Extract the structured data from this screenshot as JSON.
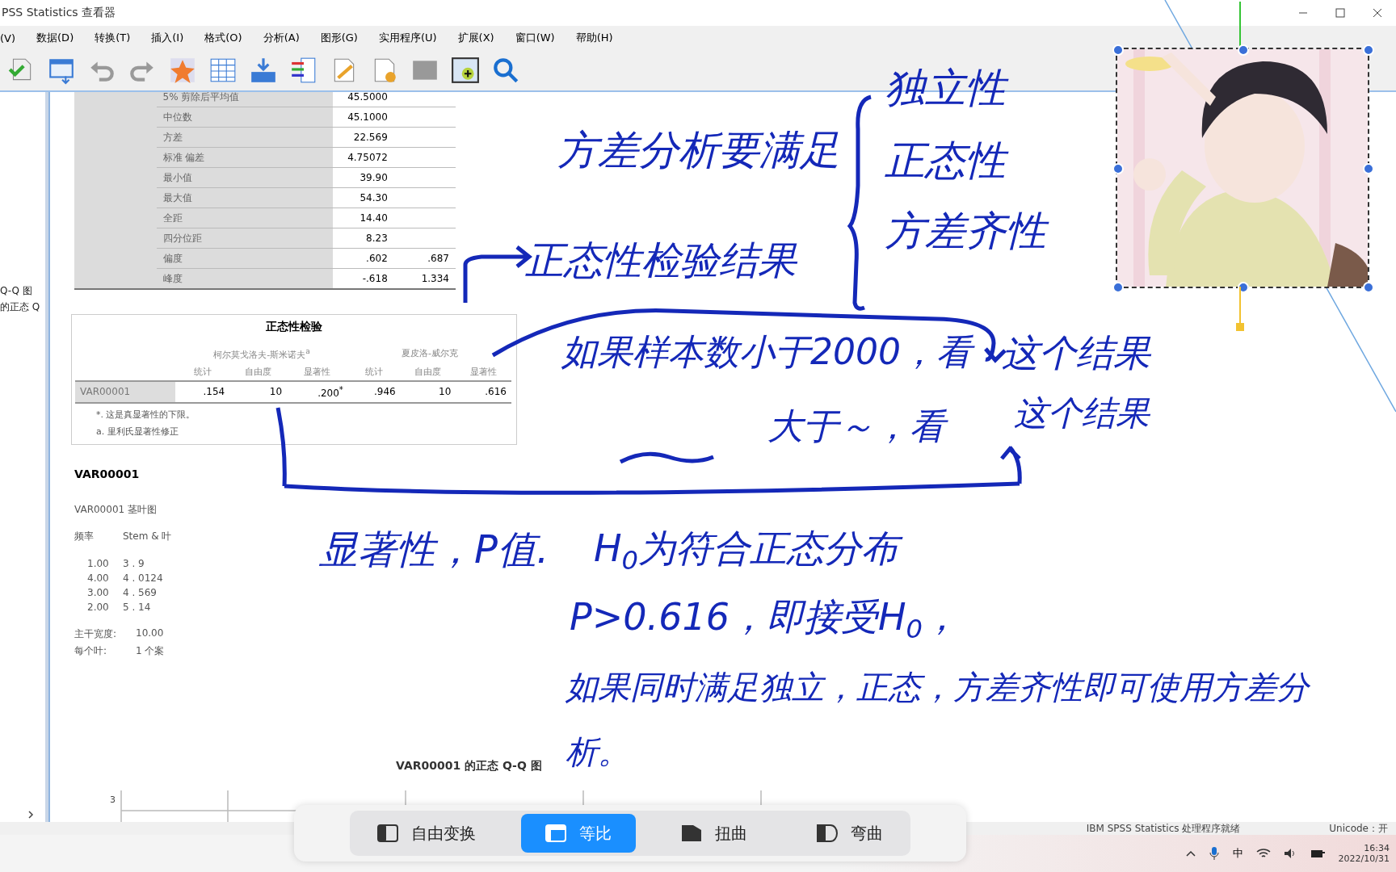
{
  "window": {
    "title": "PSS Statistics 查看器"
  },
  "menu": [
    "(V)",
    "数据(D)",
    "转换(T)",
    "插入(I)",
    "格式(O)",
    "分析(A)",
    "图形(G)",
    "实用程序(U)",
    "扩展(X)",
    "窗口(W)",
    "帮助(H)"
  ],
  "sidebar": {
    "items": [
      "Q-Q 图",
      "的正态 Q"
    ]
  },
  "descriptives": {
    "rows": [
      {
        "label": "5% 剪除后平均值",
        "value": "45.5000",
        "error": ""
      },
      {
        "label": "中位数",
        "value": "45.1000",
        "error": ""
      },
      {
        "label": "方差",
        "value": "22.569",
        "error": ""
      },
      {
        "label": "标准 偏差",
        "value": "4.75072",
        "error": ""
      },
      {
        "label": "最小值",
        "value": "39.90",
        "error": ""
      },
      {
        "label": "最大值",
        "value": "54.30",
        "error": ""
      },
      {
        "label": "全距",
        "value": "14.40",
        "error": ""
      },
      {
        "label": "四分位距",
        "value": "8.23",
        "error": ""
      },
      {
        "label": "偏度",
        "value": ".602",
        "error": ".687"
      },
      {
        "label": "峰度",
        "value": "-.618",
        "error": "1.334"
      }
    ]
  },
  "normality": {
    "title": "正态性检验",
    "groups": [
      "柯尔莫戈洛夫-斯米诺夫$^{a}$",
      "夏皮洛-威尔克"
    ],
    "columns": [
      "统计",
      "自由度",
      "显著性",
      "统计",
      "自由度",
      "显著性"
    ],
    "row": {
      "name": "VAR00001",
      "cells": [
        ".154",
        "10",
        ".200$^{*}$",
        ".946",
        "10",
        ".616"
      ]
    },
    "notes": [
      "*. 这是真显著性的下限。",
      "a. 里利氏显著性修正"
    ]
  },
  "stem_leaf": {
    "heading": "VAR00001",
    "title": "VAR00001 茎叶图",
    "columns": [
      "频率",
      "Stem & 叶"
    ],
    "rows": [
      [
        "1.00",
        "3 .  9"
      ],
      [
        "4.00",
        "4 .  0124"
      ],
      [
        "3.00",
        "4 .  569"
      ],
      [
        "2.00",
        "5 .  14"
      ]
    ],
    "footer": [
      [
        "主干宽度:",
        "10.00"
      ],
      [
        "每个叶:",
        "1 个案"
      ]
    ]
  },
  "qq": {
    "title": "VAR00001 的正态 Q-Q 图",
    "tick": "3"
  },
  "annotations": [
    "方差分析要满足",
    "独立性",
    "正态性",
    "方差齐性",
    "正态性检验结果",
    "如果样本数小于2000，看",
    "这个结果",
    "大于～，看",
    "这个结果",
    "显著性，P值.",
    "H$_{0}$为符合正态分布",
    "P>0.616，即接受H$_{0}$，",
    "如果同时满足独立，正态，方差齐性即可使用方差分",
    "析。"
  ],
  "status_bar": {
    "message": "IBM SPSS Statistics 处理程序就绪",
    "encoding": "Unicode：开"
  },
  "transform_bar": [
    {
      "label": "自由变换",
      "selected": false
    },
    {
      "label": "等比",
      "selected": true
    },
    {
      "label": "扭曲",
      "selected": false
    },
    {
      "label": "弯曲",
      "selected": false
    }
  ],
  "taskbar": {
    "ime": "中",
    "time": "16:34",
    "date": "2022/10/31"
  }
}
